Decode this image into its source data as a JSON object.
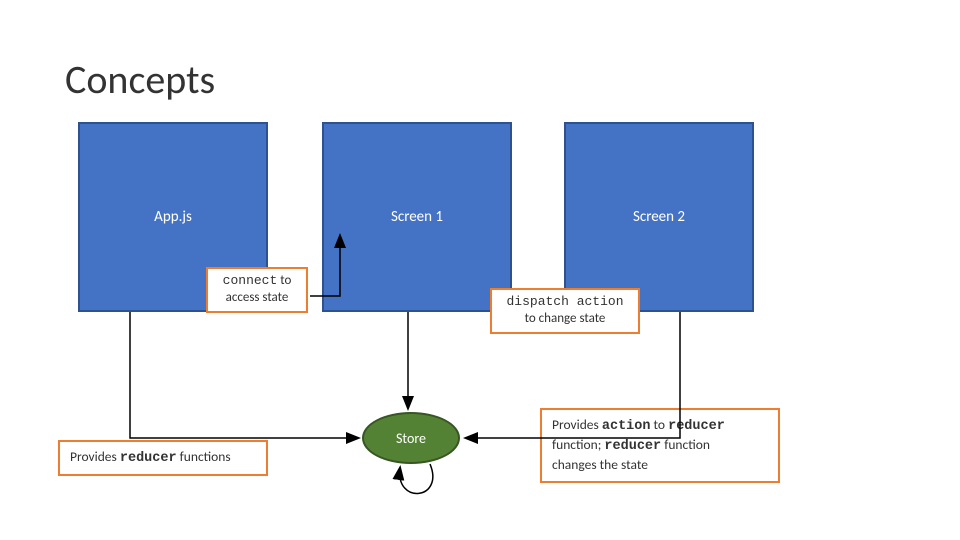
{
  "title": "Concepts",
  "nodes": {
    "app": "App.js",
    "screen1": "Screen 1",
    "screen2": "Screen 2",
    "store": "Store"
  },
  "callouts": {
    "connect_line1": "connect",
    "connect_line2": " to",
    "connect_line3": "access state",
    "dispatch_line1": "dispatch action",
    "dispatch_line2": "to change state",
    "reducer_line1": "Provides ",
    "reducer_line2": "reducer",
    "reducer_line3": " functions",
    "action_reducer_line1": "Provides ",
    "action_reducer_line2": "action",
    "action_reducer_line3": " to ",
    "action_reducer_line4": "reducer",
    "action_reducer_line5": "function; ",
    "action_reducer_line6": "reducer",
    "action_reducer_line7": " function",
    "action_reducer_line8": "changes the state"
  },
  "colors": {
    "box_fill": "#4472c4",
    "box_border": "#2e528f",
    "callout_border": "#ed7d31",
    "store_fill": "#548235",
    "store_border": "#375623",
    "arrow": "#000000"
  }
}
